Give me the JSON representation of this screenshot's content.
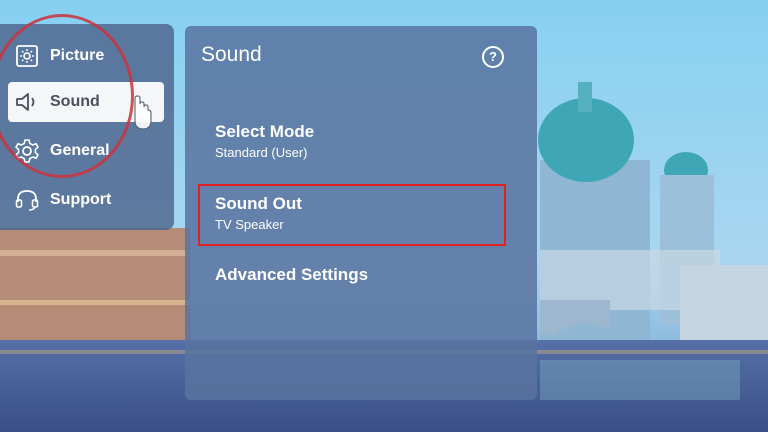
{
  "menu": {
    "items": [
      {
        "label": "Picture",
        "icon": "picture-icon"
      },
      {
        "label": "Sound",
        "icon": "speaker-icon",
        "selected": true
      },
      {
        "label": "General",
        "icon": "gear-icon"
      },
      {
        "label": "Support",
        "icon": "headset-icon"
      }
    ]
  },
  "panel": {
    "title": "Sound",
    "help_icon": "?",
    "options": [
      {
        "label": "Select Mode",
        "value": "Standard (User)"
      },
      {
        "label": "Sound Out",
        "value": "TV Speaker"
      },
      {
        "label": "Advanced Settings"
      }
    ]
  },
  "colors": {
    "highlight_box": "#e32020",
    "highlight_circle": "#cd323c",
    "selected_bg": "#f4f6f8"
  }
}
